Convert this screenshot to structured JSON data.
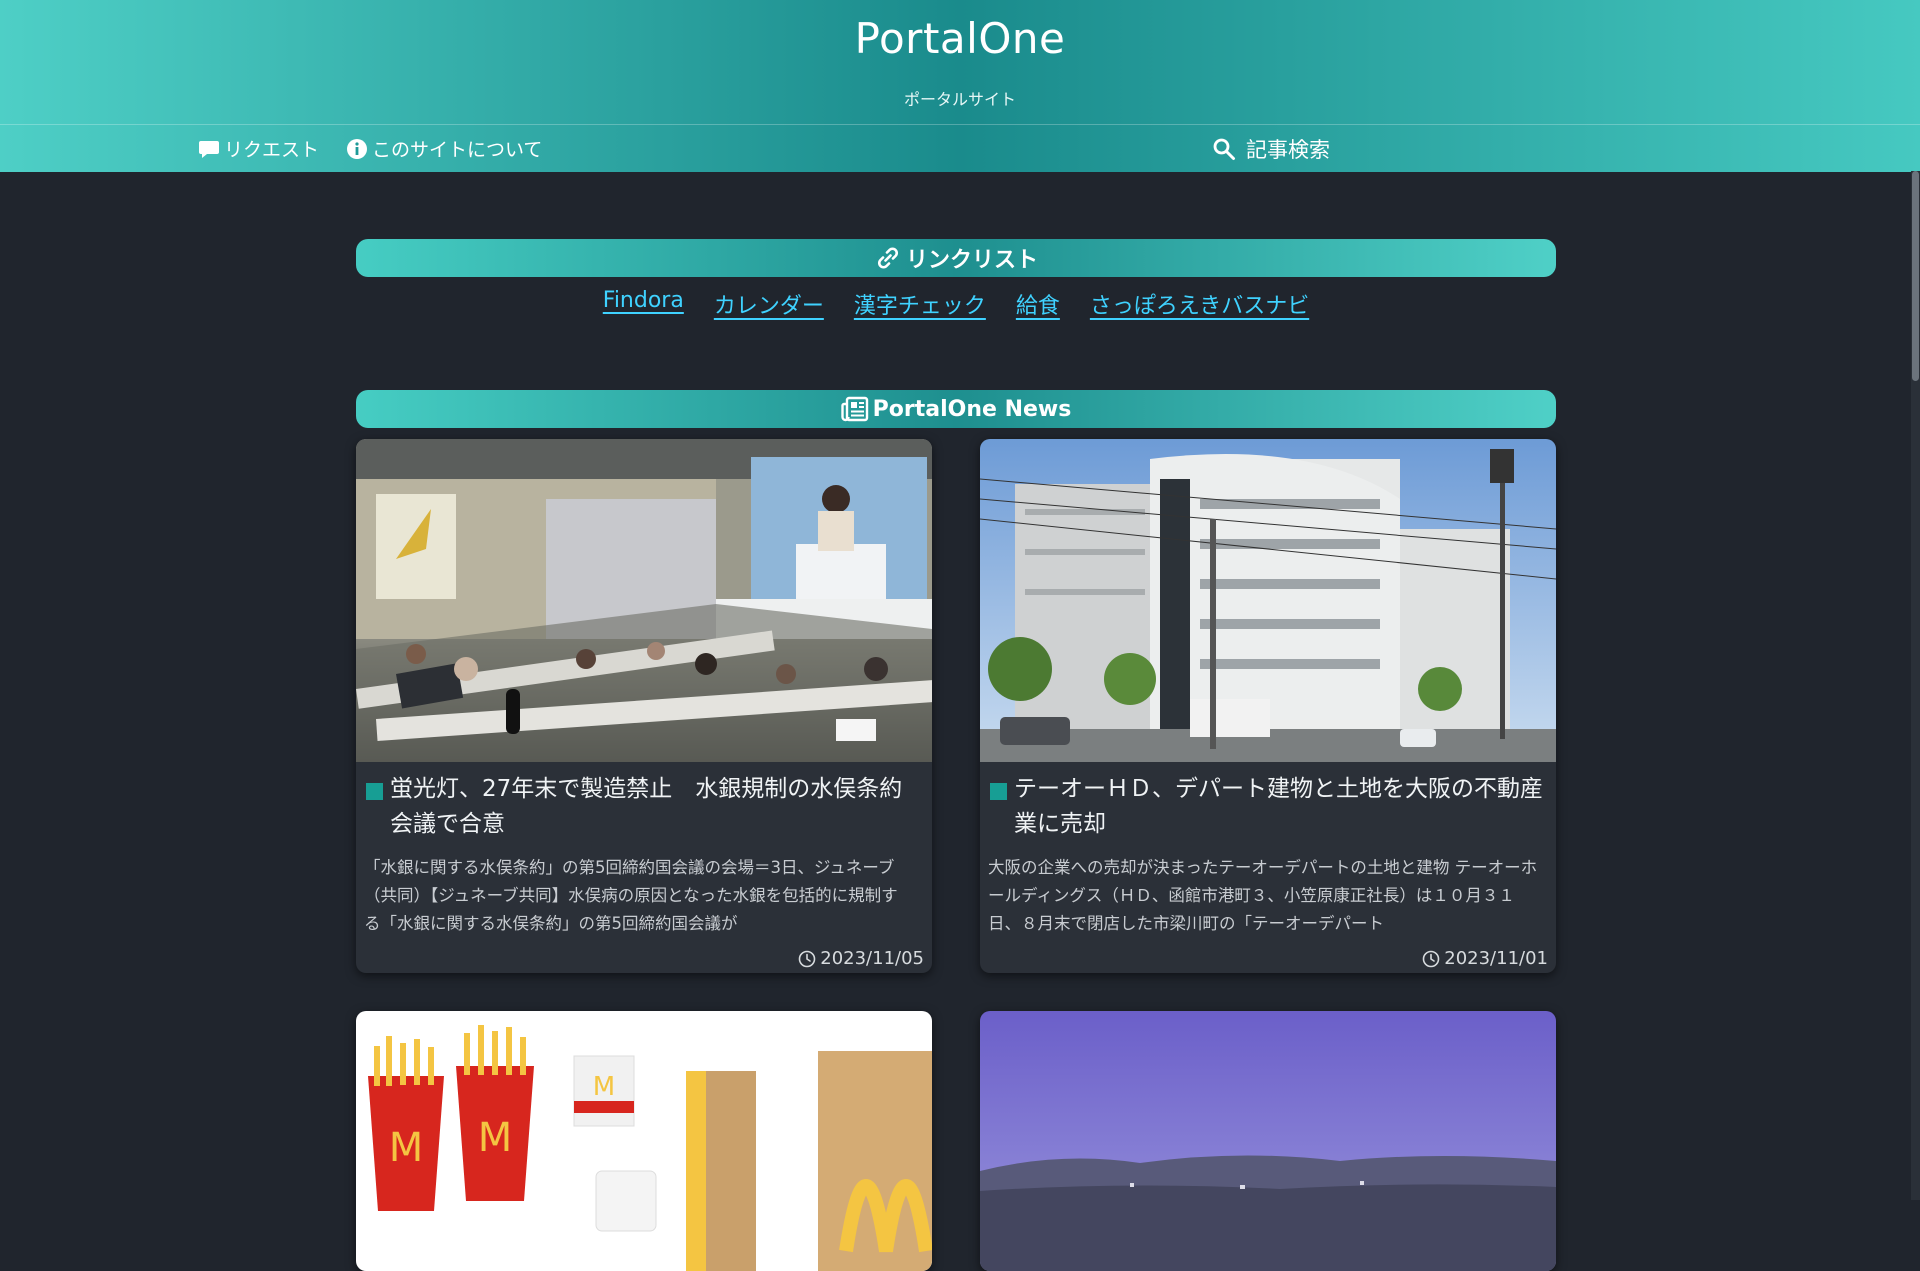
{
  "header": {
    "title": "PortalOne",
    "subtitle": "ポータルサイト"
  },
  "nav": {
    "request": "リクエスト",
    "about": "このサイトについて",
    "search": "記事検索"
  },
  "links_section": {
    "title": "リンクリスト",
    "links": [
      "Findora",
      "カレンダー",
      "漢字チェック",
      "給食",
      "さっぽろえきバスナビ"
    ]
  },
  "news_section": {
    "title": "PortalOne News",
    "articles": [
      {
        "title": "蛍光灯、27年末で製造禁止　水銀規制の水俣条約会議で合意",
        "text": "「水銀に関する水俣条約」の第5回締約国会議の会場＝3日、ジュネーブ（共同）【ジュネーブ共同】水俣病の原因となった水銀を包括的に規制する「水銀に関する水俣条約」の第5回締約国会議が",
        "date": "2023/11/05",
        "image": "conference-hall-photo"
      },
      {
        "title": "テーオーＨＤ、デパート建物と土地を大阪の不動産業に売却",
        "text": "大阪の企業への売却が決まったテーオーデパートの土地と建物 テーオーホールディングス（ＨＤ、函館市港町３、小笠原康正社長）は１０月３１日、８月末で閉店した市梁川町の「テーオーデパート",
        "date": "2023/11/01",
        "image": "department-store-building-photo"
      },
      {
        "image": "fast-food-packaging-photo"
      },
      {
        "image": "sky-landscape-photo"
      }
    ]
  },
  "colors": {
    "accent": "#1a8b8c",
    "link": "#3fd2ff",
    "background": "#20252d",
    "card": "#2b3038"
  }
}
